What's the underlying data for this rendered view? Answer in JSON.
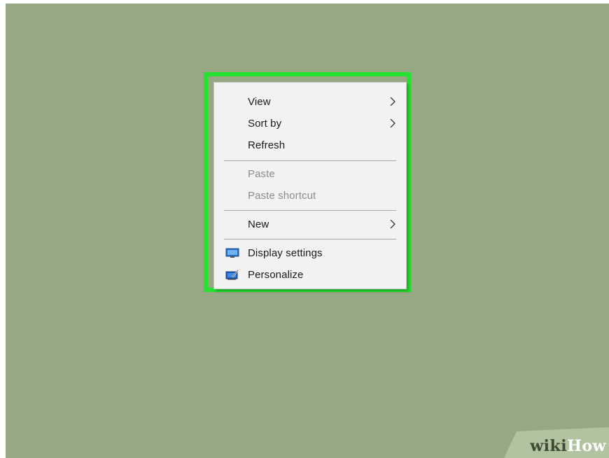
{
  "desktop": {
    "background_color": "#97a885"
  },
  "highlight": {
    "color": "#24e22d"
  },
  "context_menu": {
    "items": [
      {
        "label": "View",
        "submenu": true,
        "enabled": true
      },
      {
        "label": "Sort by",
        "submenu": true,
        "enabled": true
      },
      {
        "label": "Refresh",
        "submenu": false,
        "enabled": true
      },
      {
        "label": "Paste",
        "submenu": false,
        "enabled": false
      },
      {
        "label": "Paste shortcut",
        "submenu": false,
        "enabled": false
      },
      {
        "label": "New",
        "submenu": true,
        "enabled": true
      },
      {
        "label": "Display settings",
        "submenu": false,
        "enabled": true,
        "icon": "display-icon"
      },
      {
        "label": "Personalize",
        "submenu": false,
        "enabled": true,
        "icon": "personalize-icon"
      }
    ]
  },
  "watermark": {
    "wiki": "wiki",
    "how": "How"
  }
}
